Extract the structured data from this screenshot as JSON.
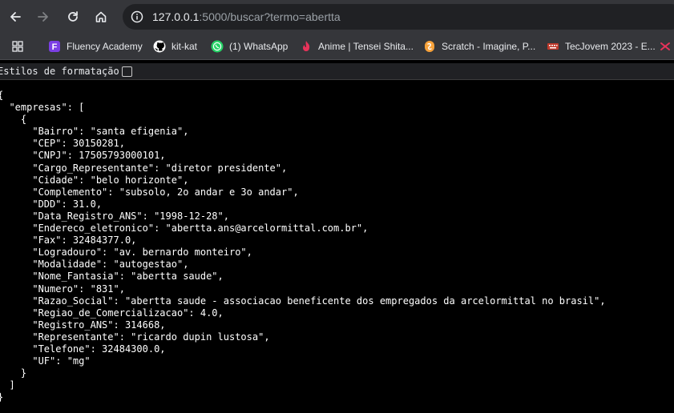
{
  "browser": {
    "url_host": "127.0.0.1",
    "url_rest": ":5000/buscar?termo=abertta",
    "bookmarks": [
      {
        "label": "Fluency Academy",
        "icon": "fluency-icon"
      },
      {
        "label": "kit-kat",
        "icon": "github-icon"
      },
      {
        "label": "(1) WhatsApp",
        "icon": "whatsapp-icon"
      },
      {
        "label": "Anime | Tensei Shita...",
        "icon": "anime-icon"
      },
      {
        "label": "Scratch - Imagine, P...",
        "icon": "scratch-icon"
      },
      {
        "label": "TecJovem 2023 - E...",
        "icon": "tecjovem-icon"
      }
    ]
  },
  "pretty_print": {
    "label": "Estilos de formatação"
  },
  "json_lines": [
    "{",
    "  \"empresas\": [",
    "    {",
    "      \"Bairro\": \"santa efigenia\",",
    "      \"CEP\": 30150281,",
    "      \"CNPJ\": 17505793000101,",
    "      \"Cargo_Representante\": \"diretor presidente\",",
    "      \"Cidade\": \"belo horizonte\",",
    "      \"Complemento\": \"subsolo, 2o andar e 3o andar\",",
    "      \"DDD\": 31.0,",
    "      \"Data_Registro_ANS\": \"1998-12-28\",",
    "      \"Endereco_eletronico\": \"abertta.ans@arcelormittal.com.br\",",
    "      \"Fax\": 32484377.0,",
    "      \"Logradouro\": \"av. bernardo monteiro\",",
    "      \"Modalidade\": \"autogestao\",",
    "      \"Nome_Fantasia\": \"abertta saude\",",
    "      \"Numero\": \"831\",",
    "      \"Razao_Social\": \"abertta saude - associacao beneficente dos empregados da arcelormittal no brasil\",",
    "      \"Regiao_de_Comercializacao\": 4.0,",
    "      \"Registro_ANS\": 314668,",
    "      \"Representante\": \"ricardo dupin lustosa\",",
    "      \"Telefone\": 32484300.0,",
    "      \"UF\": \"mg\"",
    "    }",
    "  ]",
    "}"
  ]
}
